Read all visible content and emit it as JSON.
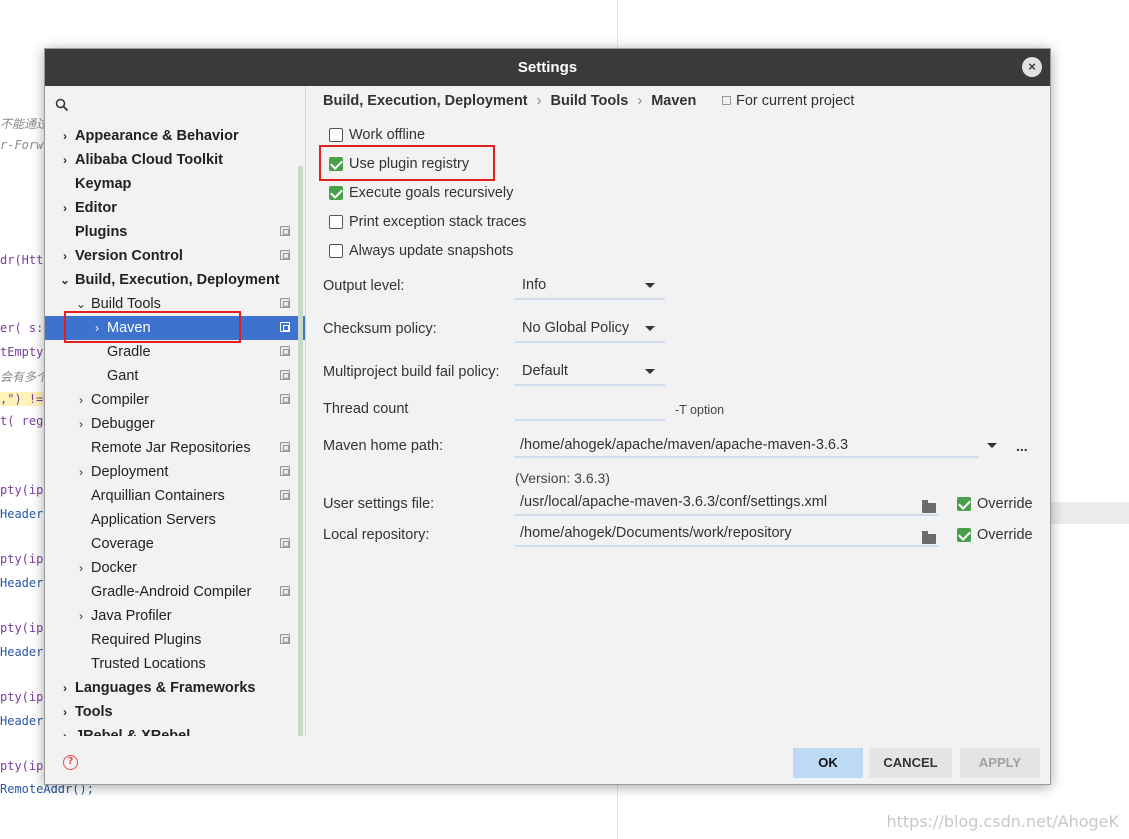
{
  "background": {
    "code_lines": [
      "不能通过",
      "r-Forwa",
      "dr(Htt",
      "er( s:",
      "tEmpty",
      "会有多个",
      ",\") !=",
      "t( rege",
      "pty(ip",
      "Header",
      "pty(ip",
      "Header",
      "pty(ip",
      "Header",
      "pty(ip",
      "Header",
      "pty(ip",
      "RemoteAddr();"
    ],
    "watermark": "https://blog.csdn.net/AhogeK"
  },
  "dialog": {
    "title": "Settings",
    "close_icon": "×"
  },
  "sidebar": {
    "search_icon": "search-icon",
    "items": [
      {
        "label": "Appearance & Behavior",
        "arrow": "›",
        "bold": true
      },
      {
        "label": "Alibaba Cloud Toolkit",
        "arrow": "›",
        "bold": true
      },
      {
        "label": "Keymap",
        "arrow": "",
        "bold": true
      },
      {
        "label": "Editor",
        "arrow": "›",
        "bold": true
      },
      {
        "label": "Plugins",
        "arrow": "",
        "bold": true,
        "project": true
      },
      {
        "label": "Version Control",
        "arrow": "›",
        "bold": true,
        "project": true
      },
      {
        "label": "Build, Execution, Deployment",
        "arrow": "⌄",
        "bold": true
      },
      {
        "label": "Build Tools",
        "arrow": "⌄",
        "project": true
      },
      {
        "label": "Maven",
        "arrow": "›",
        "project": true,
        "selected": true
      },
      {
        "label": "Gradle",
        "arrow": "",
        "project": true
      },
      {
        "label": "Gant",
        "arrow": "",
        "project": true
      },
      {
        "label": "Compiler",
        "arrow": "›",
        "project": true
      },
      {
        "label": "Debugger",
        "arrow": "›"
      },
      {
        "label": "Remote Jar Repositories",
        "arrow": "",
        "project": true
      },
      {
        "label": "Deployment",
        "arrow": "›",
        "project": true
      },
      {
        "label": "Arquillian Containers",
        "arrow": "",
        "project": true
      },
      {
        "label": "Application Servers",
        "arrow": ""
      },
      {
        "label": "Coverage",
        "arrow": "",
        "project": true
      },
      {
        "label": "Docker",
        "arrow": "›"
      },
      {
        "label": "Gradle-Android Compiler",
        "arrow": "",
        "project": true
      },
      {
        "label": "Java Profiler",
        "arrow": "›"
      },
      {
        "label": "Required Plugins",
        "arrow": "",
        "project": true
      },
      {
        "label": "Trusted Locations",
        "arrow": ""
      },
      {
        "label": "Languages & Frameworks",
        "arrow": "›",
        "bold": true
      },
      {
        "label": "Tools",
        "arrow": "›",
        "bold": true
      },
      {
        "label": "JRebel & XRebel",
        "arrow": "›",
        "bold": true
      }
    ]
  },
  "breadcrumb": {
    "parts": [
      "Build, Execution, Deployment",
      "Build Tools",
      "Maven"
    ],
    "separator": "›",
    "scope": "For current project"
  },
  "options": [
    {
      "label": "Work offline",
      "checked": false
    },
    {
      "label": "Use plugin registry",
      "checked": true
    },
    {
      "label": "Execute goals recursively",
      "checked": true
    },
    {
      "label": "Print exception stack traces",
      "checked": false
    },
    {
      "label": "Always update snapshots",
      "checked": false
    }
  ],
  "fields": {
    "output_level": {
      "label": "Output level:",
      "value": "Info"
    },
    "checksum_policy": {
      "label": "Checksum policy:",
      "value": "No Global Policy"
    },
    "fail_policy": {
      "label": "Multiproject build fail policy:",
      "value": "Default"
    },
    "thread_count": {
      "label": "Thread count",
      "value": "",
      "hint": "-T option"
    },
    "maven_home": {
      "label": "Maven home path:",
      "value": "/home/ahogek/apache/maven/apache-maven-3.6.3",
      "version": "(Version: 3.6.3)",
      "browse": "..."
    },
    "user_settings": {
      "label": "User settings file:",
      "value": "/usr/local/apache-maven-3.6.3/conf/settings.xml",
      "override_label": "Override",
      "override_checked": true
    },
    "local_repo": {
      "label": "Local repository:",
      "value": "/home/ahogek/Documents/work/repository",
      "override_label": "Override",
      "override_checked": true
    }
  },
  "buttons": {
    "ok": "OK",
    "cancel": "CANCEL",
    "apply": "APPLY"
  },
  "help_icon": "?"
}
